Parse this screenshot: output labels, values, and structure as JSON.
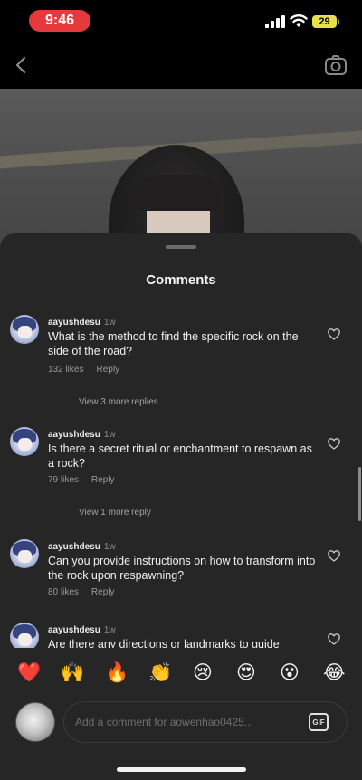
{
  "status_bar": {
    "time": "9:46",
    "battery": "29"
  },
  "sheet": {
    "title": "Comments"
  },
  "comments": [
    {
      "username": "aayushdesu",
      "time": "1w",
      "text": "What is the method to find the specific rock on the side of the road?",
      "likes": "132 likes",
      "reply": "Reply",
      "view_replies": "View 3 more replies"
    },
    {
      "username": "aayushdesu",
      "time": "1w",
      "text": "Is there a secret ritual or enchantment to respawn as a rock?",
      "likes": "79 likes",
      "reply": "Reply",
      "view_replies": "View 1 more reply"
    },
    {
      "username": "aayushdesu",
      "time": "1w",
      "text": "Can you provide instructions on how to transform into the rock upon respawning?",
      "likes": "80 likes",
      "reply": "Reply"
    },
    {
      "username": "aayushdesu",
      "time": "1w",
      "text": "Are there any directions or landmarks to guide"
    }
  ],
  "emojis": [
    "❤️",
    "🙌",
    "🔥",
    "👏",
    "😢",
    "😍",
    "😮",
    "😂"
  ],
  "input": {
    "placeholder": "Add a comment for aowenhao0425...",
    "gif_label": "GIF"
  },
  "icons": {
    "back": "chevron-left-icon",
    "camera": "camera-icon",
    "like": "heart-outline-icon"
  }
}
